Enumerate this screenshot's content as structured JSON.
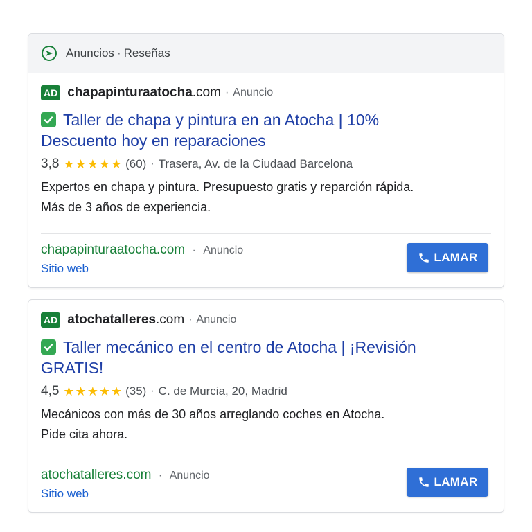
{
  "header": {
    "icon": "megaphone-icon",
    "label_anuncios": "Anuncios",
    "separator": "·",
    "label_resenas": "Reseñas"
  },
  "ads": [
    {
      "badge": "AD",
      "domain_bold": "chapapinturaatocha",
      "domain_tld": ".com",
      "separator": "·",
      "anuncio_label": "Anuncio",
      "title_line1": "Taller de chapa y pintura en an Atocha | 10%",
      "title_line2": "Descuento hoy en reparaciones",
      "rating": "3,8",
      "stars": "★★★★★",
      "reviews": "(60)",
      "rating_separator": "·",
      "address": "Trasera, Av. de la Ciudaad Barcelona",
      "desc_line1": "Expertos en chapa y pintura. Presupuesto gratis y reparción rápida.",
      "desc_line2": "Más de 3 años de experiencia.",
      "footer_domain": "chapapinturaatocha.com",
      "footer_separator": "·",
      "footer_anuncio": "Anuncio",
      "sitio_label": "Sitio web",
      "call_label": "LAMAR"
    },
    {
      "badge": "AD",
      "domain_bold": "atochatalleres",
      "domain_tld": ".com",
      "separator": "·",
      "anuncio_label": "Anuncio",
      "title_line1": "Taller mecánico en el centro de Atocha | ¡Revisión",
      "title_line2": "GRATIS!",
      "rating": "4,5",
      "stars": "★★★★★",
      "reviews": "(35)",
      "rating_separator": "·",
      "address": "C. de Murcia, 20, Madrid",
      "desc_line1": "Mecánicos con más de 30 años arreglando coches en Atocha.",
      "desc_line2": "Pide cita ahora.",
      "footer_domain": "atochatalleres.com",
      "footer_separator": "·",
      "footer_anuncio": "Anuncio",
      "sitio_label": "Sitio web",
      "call_label": "LAMAR"
    }
  ],
  "colors": {
    "ad_badge": "#188038",
    "title_link": "#1f3fa6",
    "stars": "#fbbc04",
    "call_button": "#2f6fd6",
    "footer_domain": "#188038"
  }
}
